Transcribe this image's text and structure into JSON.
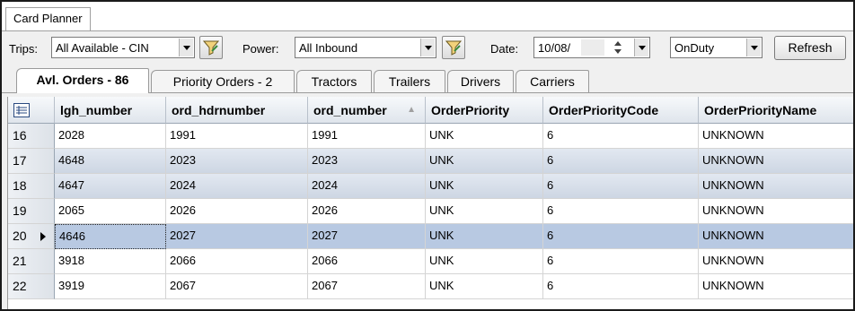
{
  "window": {
    "title": "Card Planner"
  },
  "toolbar": {
    "trips_label": "Trips:",
    "trips_value": "All Available - CIN",
    "power_label": "Power:",
    "power_value": "All Inbound",
    "date_label": "Date:",
    "date_value": "10/08/",
    "status_value": "OnDuty",
    "refresh_label": "Refresh"
  },
  "tabs": [
    {
      "label": "Avl. Orders - 86",
      "active": true
    },
    {
      "label": "Priority Orders - 2"
    },
    {
      "label": "Tractors"
    },
    {
      "label": "Trailers"
    },
    {
      "label": "Drivers"
    },
    {
      "label": "Carriers"
    }
  ],
  "grid": {
    "columns": [
      "lgh_number",
      "ord_hdrnumber",
      "ord_number",
      "OrderPriority",
      "OrderPriorityCode",
      "OrderPriorityName"
    ],
    "sorted_column": "ord_number",
    "rows": [
      {
        "num": "16",
        "cells": [
          "2028",
          "1991",
          "1991",
          "UNK",
          "6",
          "UNKNOWN"
        ]
      },
      {
        "num": "17",
        "cells": [
          "4648",
          "2023",
          "2023",
          "UNK",
          "6",
          "UNKNOWN"
        ]
      },
      {
        "num": "18",
        "cells": [
          "4647",
          "2024",
          "2024",
          "UNK",
          "6",
          "UNKNOWN"
        ]
      },
      {
        "num": "19",
        "cells": [
          "2065",
          "2026",
          "2026",
          "UNK",
          "6",
          "UNKNOWN"
        ]
      },
      {
        "num": "20",
        "cells": [
          "4646",
          "2027",
          "2027",
          "UNK",
          "6",
          "UNKNOWN"
        ]
      },
      {
        "num": "21",
        "cells": [
          "3918",
          "2066",
          "2066",
          "UNK",
          "6",
          "UNKNOWN"
        ]
      },
      {
        "num": "22",
        "cells": [
          "3919",
          "2067",
          "2067",
          "UNK",
          "6",
          "UNKNOWN"
        ]
      }
    ],
    "selected_row": "20",
    "highlight_rows": [
      "17",
      "18"
    ]
  },
  "colors": {
    "selection": "#b8c9e2",
    "highlight": "#d6dde8",
    "header": "#dfe5ec"
  },
  "icons": {
    "column_chooser": "column-chooser-icon",
    "filter": "filter-funnel-icon",
    "sort": "sort-indicator-icon",
    "row_pointer": "row-pointer-icon"
  }
}
